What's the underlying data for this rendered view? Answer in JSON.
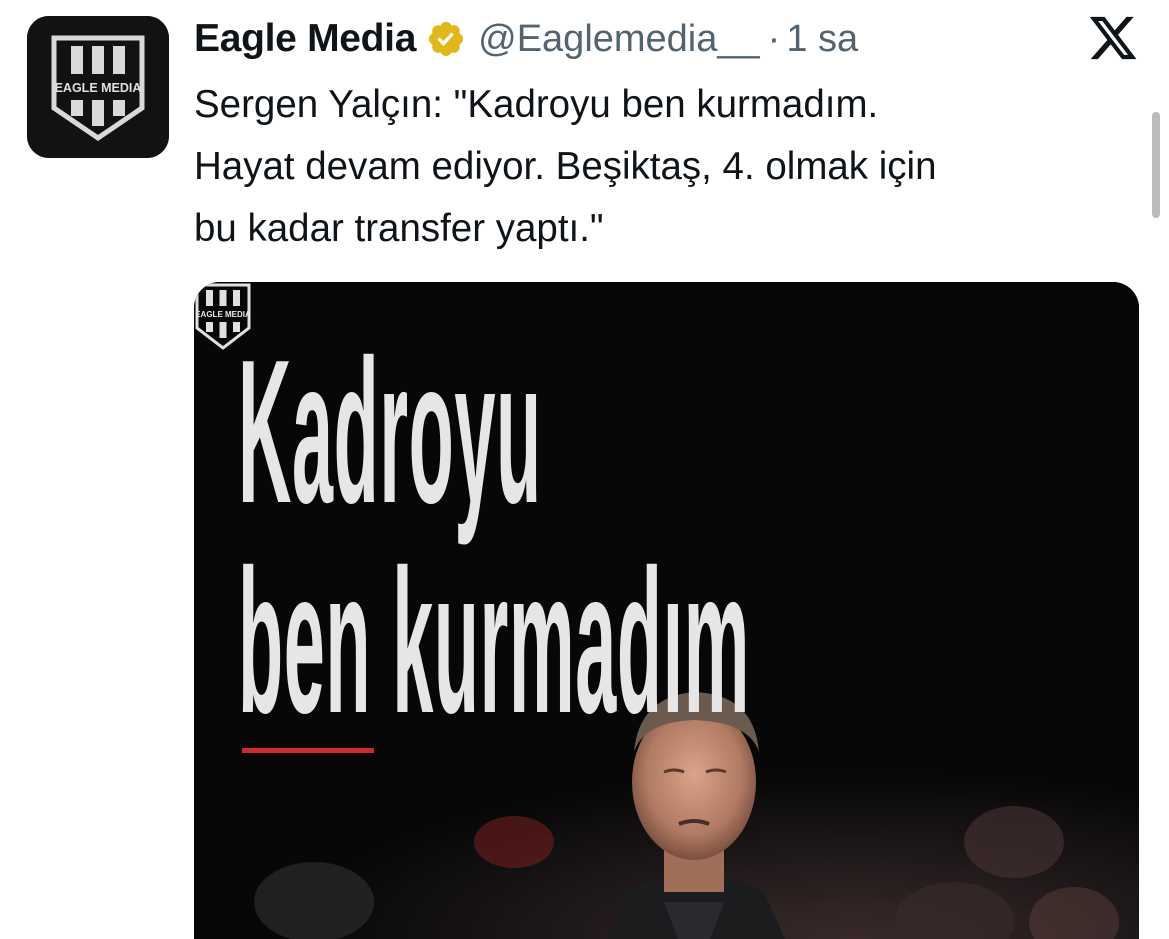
{
  "tweet": {
    "display_name": "Eagle Media",
    "handle": "@Eaglemedia__",
    "separator": "·",
    "time": "1 sa",
    "text_lines": [
      "Sergen Yalçın: \"Kadroyu ben kurmadım.",
      "Hayat devam ediyor. Beşiktaş, 4. olmak için",
      "bu kadar transfer yaptı.\""
    ]
  },
  "avatar": {
    "icon": "eagle-media-shield-logo",
    "logo_text": "EAGLE MEDIA"
  },
  "media": {
    "headline_line1": "Kadroyu",
    "headline_line2": "ben kurmadım",
    "logo_text": "EAGLE MEDIA",
    "accent_color": "#d62828"
  },
  "icons": {
    "verified": "verified-badge-icon",
    "platform": "x-logo-icon"
  },
  "colors": {
    "text_primary": "#0f1419",
    "text_secondary": "#536471",
    "verified_gold": "#e2b719"
  }
}
